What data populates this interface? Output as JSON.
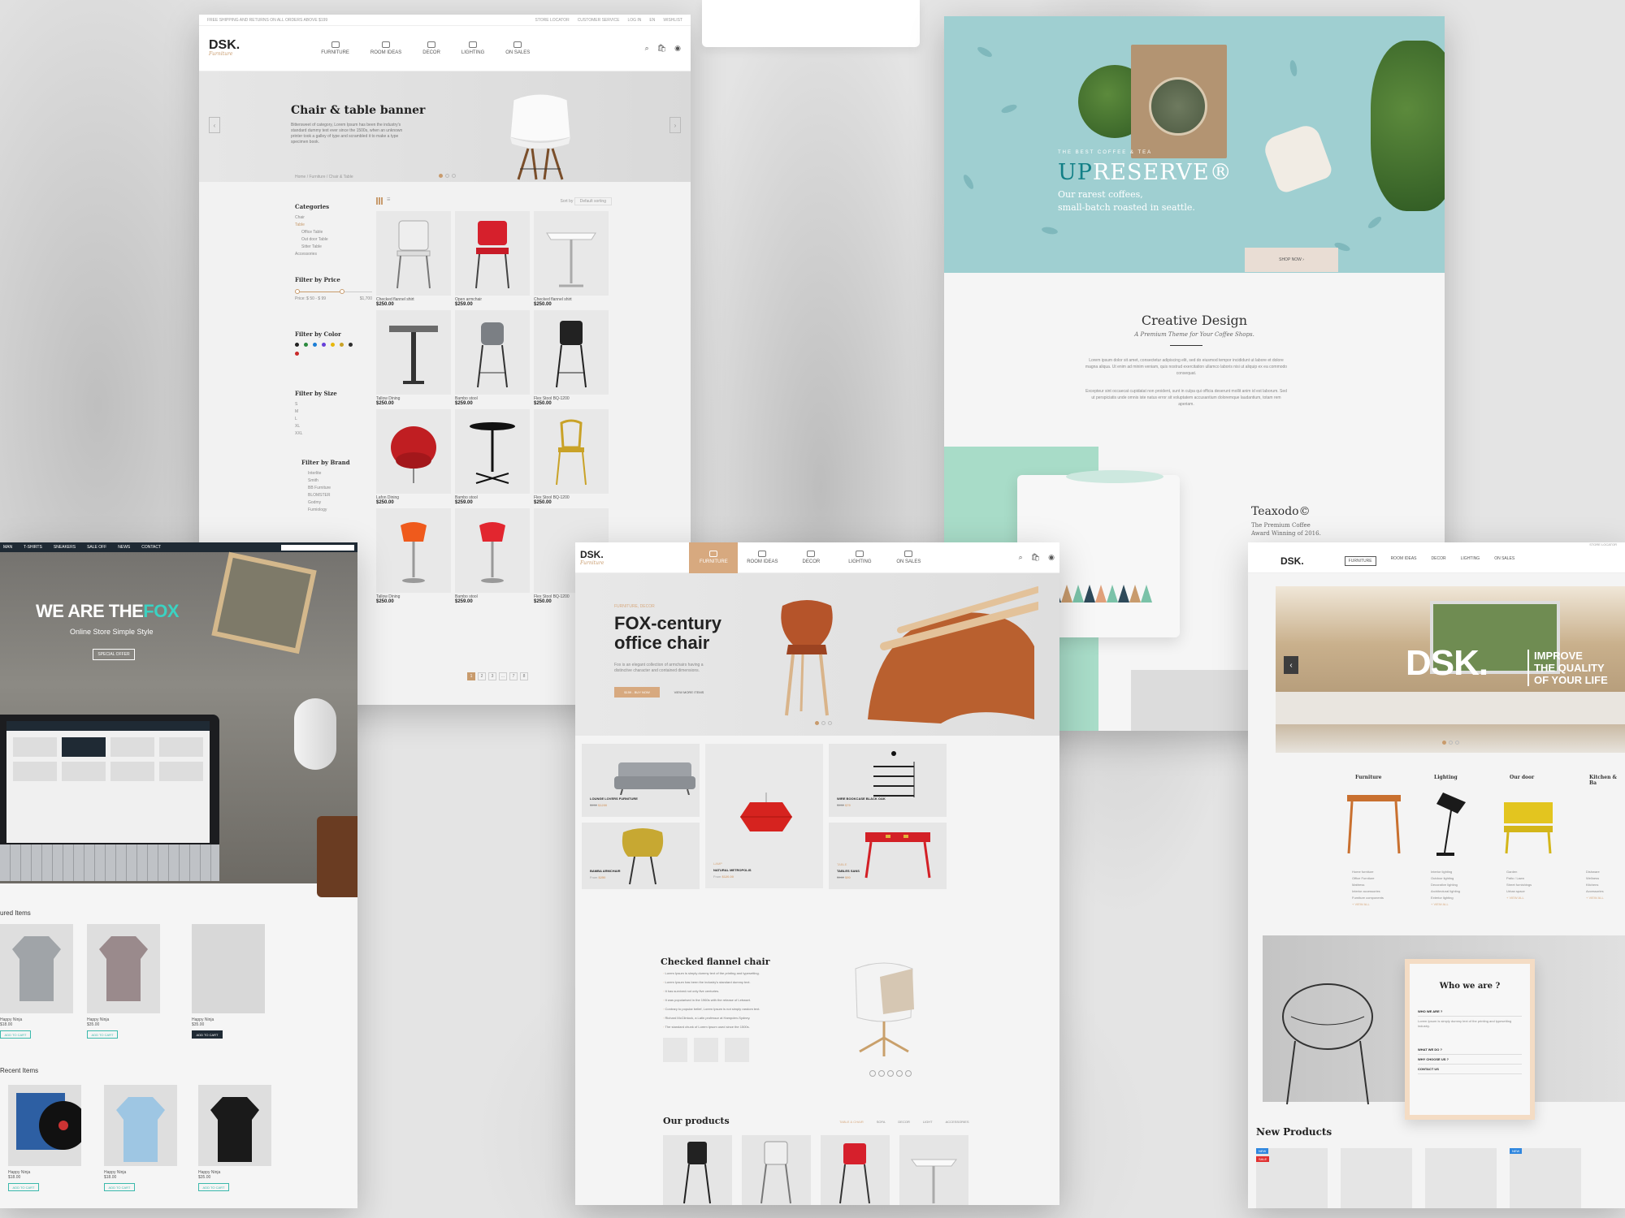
{
  "panel_a": {
    "topbar_left": "FREE SHIPPING AND RETURNS ON ALL ORDERS ABOVE $199",
    "topbar_links": [
      "STORE LOCATOR",
      "CUSTOMER SERVICE",
      "LOG IN",
      "EN",
      "WISHLIST"
    ],
    "logo": "DSK.",
    "logo_sub": "Furniture",
    "nav": [
      "FURNITURE",
      "ROOM IDEAS",
      "DECOR",
      "LIGHTING",
      "ON SALES"
    ],
    "hero_title": "Chair & table banner",
    "hero_text": "Bittersweet of category, Lorem Ipsum has been the industry's standard dummy text ever since the 1500s, when an unknown printer took a galley of type and scrambled it to make a type specimen book.",
    "breadcrumb": "Home  /  Furniture  /  Chair & Table",
    "sort_label": "Sort by",
    "sort_value": "Default sorting",
    "categories_title": "Categories",
    "categories": [
      "Chair",
      "Table",
      "Office Table",
      "Out door Table",
      "Sitter Table",
      "Accessories"
    ],
    "price_title": "Filter by Price",
    "price_range": "Price: $ 50 - $ 99",
    "price_max": "$1,700",
    "color_title": "Filter by Color",
    "colors": [
      "#222222",
      "#2b8a3e",
      "#1c7ed6",
      "#6741d9",
      "#e8b80c",
      "#c9a227",
      "#2f2f2f",
      "#c92a2a"
    ],
    "size_title": "Filter by Size",
    "sizes": [
      "S",
      "M",
      "L",
      "XL",
      "XXL"
    ],
    "brand_title": "Filter by Brand",
    "brands": [
      "Interlite",
      "Smith",
      "BB Furniture",
      "BLOMSTER",
      "Godmy",
      "Furniology"
    ],
    "products": [
      {
        "name": "Checked flannel shirt",
        "price": "$250.00"
      },
      {
        "name": "Open armchair",
        "price": "$259.00"
      },
      {
        "name": "Checked flannel shirt",
        "price": "$250.00"
      },
      {
        "name": "Tallow Dining",
        "price": "$250.00"
      },
      {
        "name": "Bambo stool",
        "price": "$259.00"
      },
      {
        "name": "Flex Stool BQ-1200",
        "price": "$250.00"
      },
      {
        "name": "Lafon Dining",
        "price": "$250.00"
      },
      {
        "name": "Bambo stool",
        "price": "$259.00"
      },
      {
        "name": "Flex Stool BQ-1200",
        "price": "$250.00"
      },
      {
        "name": "Tallow Dining",
        "price": "$250.00"
      },
      {
        "name": "Bambo stool",
        "price": "$259.00"
      },
      {
        "name": "Flex Stool BQ-1200",
        "price": "$250.00"
      }
    ],
    "pages": [
      "1",
      "2",
      "3",
      "...",
      "7",
      "8"
    ]
  },
  "panel_b": {
    "kicker": "THE BEST COFFEE & TEA",
    "brand_prefix": "UP",
    "brand_rest": "RESERVE®",
    "tagline_1": "Our rarest coffees,",
    "tagline_2": "small-batch roasted in seattle.",
    "shop_now": "SHOP NOW",
    "section_title": "Creative Design",
    "section_sub": "A Premium Theme for Your Coffee Shops.",
    "para_1": "Lorem ipsum dolor sit amet, consectetur adipiscing elit, sed do eiusmod tempor incididunt ut labore et dolore magna aliqua. Ut enim ad minim veniam, quis nostrud exercitation ullamco laboris nisi ut aliquip ex ea commodo consequat.",
    "para_2": "Excepteur sint occaecat cupidatat non proident, sunt in culpa qui officia deserunt mollit anim id est laborum. Sed ut perspiciatis unde omnis iste natus error sit voluptatem accusantium doloremque laudantium, totam rem aperiam.",
    "teaxodo": "Teaxodo©",
    "teaxodo_sub_1": "The Premium Coffee",
    "teaxodo_sub_2": "Award Winning of 2016."
  },
  "panel_c": {
    "nav": [
      "MAN",
      "T-SHIRTS",
      "SNEAKERS",
      "SALE OFF",
      "NEWS",
      "CONTACT"
    ],
    "hero_title_1": "WE ARE THE",
    "hero_title_2": "FOX",
    "hero_sub": "Online Store Simple Style",
    "hero_btn": "SPECIAL OFFER",
    "featured_title": "ured Items",
    "recent_title": "Recent Items",
    "items": [
      {
        "name": "Happy Ninja",
        "price": "$18.00",
        "cart": "ADD TO CART"
      },
      {
        "name": "Happy Ninja",
        "price": "$35.00",
        "cart": "ADD TO CART"
      },
      {
        "name": "Happy Ninja",
        "price": "$35.00",
        "cart": "ADD TO CART"
      }
    ],
    "recent": [
      {
        "name": "Happy Ninja",
        "price": "$18.00",
        "cart": "ADD TO CART"
      },
      {
        "name": "Happy Ninja",
        "price": "$18.00",
        "cart": "ADD TO CART"
      },
      {
        "name": "Happy Ninja",
        "price": "$35.00",
        "cart": "ADD TO CART"
      }
    ]
  },
  "panel_d": {
    "logo": "DSK.",
    "logo_sub": "Furniture",
    "nav": [
      "FURNITURE",
      "ROOM IDEAS",
      "DECOR",
      "LIGHTING",
      "ON SALES"
    ],
    "hero_kicker": "FURNITURE, DECOR",
    "hero_title_1": "FOX-century",
    "hero_title_2": "office chair",
    "hero_text": "Fox is an elegant collection of armchairs having a distinctive character and contained dimensions.",
    "btn_buy": "$159 - BUY NOW",
    "btn_view": "VIEW MORE ITEMS",
    "tiles": [
      {
        "cat": "",
        "name": "LOUNGE LOVERS FURNITURE",
        "old": "$150",
        "price": "$1200"
      },
      {
        "cat": "",
        "name": "WIRE BOOKCASE BLACK OAK",
        "old": "$150",
        "price": "$79"
      },
      {
        "cat": "LAMP",
        "name": "NATURAL METROPOLIS",
        "old": "From",
        "price": "$120.00"
      },
      {
        "cat": "",
        "name": "BAMBA ARMCHAIR",
        "old": "From",
        "price": "$250"
      },
      {
        "cat": "TABLE",
        "name": "TABLES SANS",
        "old": "$160",
        "price": "$90"
      }
    ],
    "feature_title": "Checked flannel chair",
    "feature_list": [
      "Lorem Ipsum is simply dummy text of the printing and typesetting.",
      "Lorem Ipsum has been the industry's standard dummy text.",
      "It has survived not only five centuries.",
      "It was popularised in the 1960s with the release of Letraset.",
      "Contrary to popular belief, Lorem Ipsum is not simply random text.",
      "Richard McClintock, a Latin professor at Hampden-Sydney.",
      "The standard chunk of Lorem Ipsum used since the 1500s."
    ],
    "products_title": "Our products",
    "product_tabs": [
      "TABLE & CHAIR",
      "SOFA",
      "DECOR",
      "LIGHT",
      "ACCESSORIES"
    ]
  },
  "panel_e": {
    "topbar": "STORE LOCATOR",
    "logo": "DSK.",
    "nav": [
      "FURNITURE",
      "ROOM IDEAS",
      "DECOR",
      "LIGHTING",
      "ON SALES"
    ],
    "hero_big": "DSK.",
    "hero_slogan": [
      "IMPROVE",
      "THE QUALITY",
      "OF YOUR LIFE"
    ],
    "categories": [
      "Furniture",
      "Lighting",
      "Our door",
      "Kitchen & Ba"
    ],
    "about_title": "Who we are ?",
    "accordion": [
      "WHO WE ARE ?",
      "WHAT WE DO ?",
      "WHY CHOOSE US ?",
      "CONTACT US"
    ],
    "new_products_title": "New Products",
    "badges": [
      "NEW",
      "SALE",
      "NEW"
    ]
  }
}
